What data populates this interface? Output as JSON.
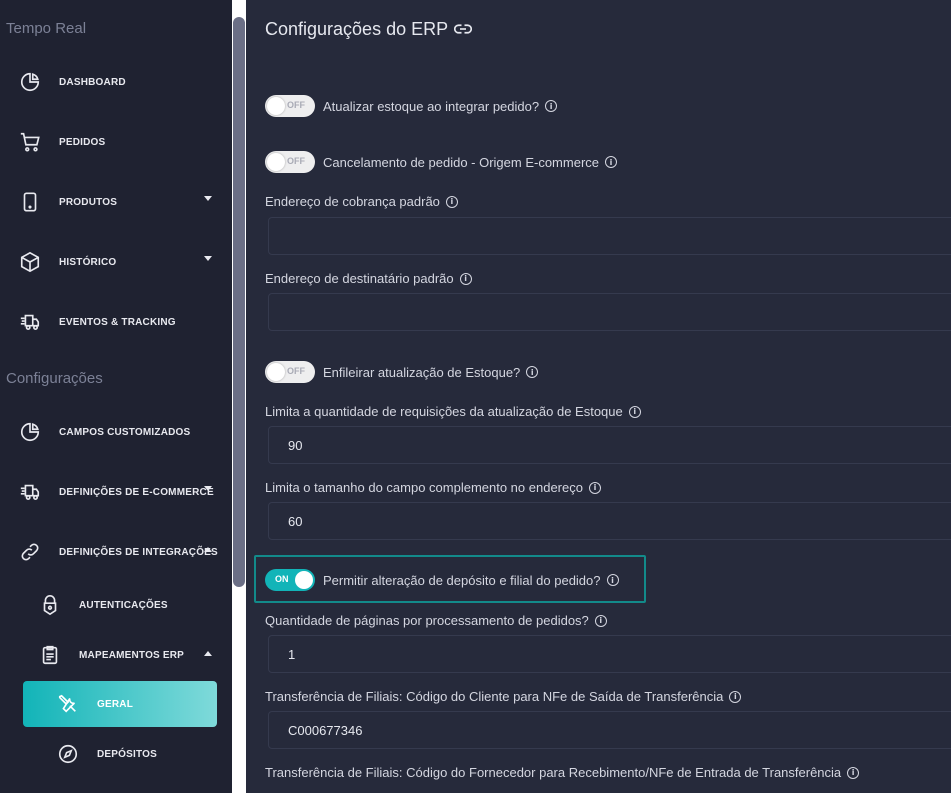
{
  "sidebar": {
    "section_realtime": "Tempo Real",
    "section_config": "Configurações",
    "items": {
      "dashboard": "DASHBOARD",
      "pedidos": "PEDIDOS",
      "produtos": "PRODUTOS",
      "historico": "HISTÓRICO",
      "eventos": "EVENTOS & TRACKING",
      "campos": "CAMPOS CUSTOMIZADOS",
      "ecommerce": "DEFINIÇÕES DE E-COMMERCE",
      "integracoes": "DEFINIÇÕES DE INTEGRAÇÕES",
      "autenticacoes": "AUTENTICAÇÕES",
      "mapeamentos": "MAPEAMENTOS ERP",
      "geral": "GERAL",
      "depositos": "DEPÓSITOS"
    }
  },
  "main": {
    "title": "Configurações do ERP",
    "info_glyph": "i",
    "toggles": {
      "atualizar_estoque": {
        "state": "OFF",
        "label": "Atualizar estoque ao integrar pedido?"
      },
      "cancelamento": {
        "state": "OFF",
        "label": "Cancelamento de pedido - Origem E-commerce"
      },
      "enfileirar": {
        "state": "OFF",
        "label": "Enfileirar atualização de Estoque?"
      },
      "permitir": {
        "state": "ON",
        "label": "Permitir alteração de depósito e filial do pedido?"
      }
    },
    "fields": {
      "cobranca": {
        "label": "Endereço de cobrança padrão",
        "value": ""
      },
      "destinatario": {
        "label": "Endereço de destinatário padrão",
        "value": ""
      },
      "limita_req": {
        "label": "Limita a quantidade de requisições da atualização de Estoque",
        "value": "90"
      },
      "limita_tam": {
        "label": "Limita o tamanho do campo complemento no endereço",
        "value": "60"
      },
      "qtd_paginas": {
        "label": "Quantidade de páginas por processamento de pedidos?",
        "value": "1"
      },
      "transf_cliente": {
        "label": "Transferência de Filiais: Código do Cliente para NFe de Saída de Transferência",
        "value": "C000677346"
      },
      "transf_fornecedor": {
        "label": "Transferência de Filiais: Código do Fornecedor para Recebimento/NFe de Entrada de Transferência",
        "value": ""
      }
    }
  },
  "colors": {
    "accent": "#12b4b8",
    "sidebar_bg": "#1f2231",
    "main_bg": "#262a3b"
  }
}
